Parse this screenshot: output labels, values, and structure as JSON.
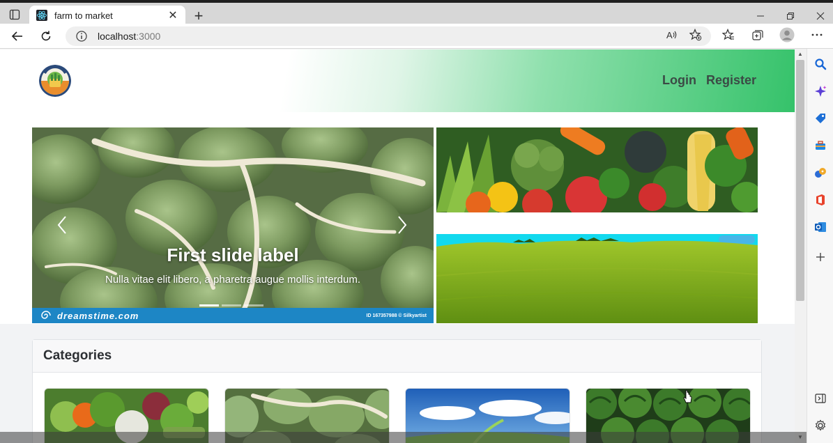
{
  "browser": {
    "tab_title": "farm to market",
    "url_host": "localhost",
    "url_port": ":3000"
  },
  "site": {
    "nav": {
      "login": "Login",
      "register": "Register"
    }
  },
  "carousel": {
    "title": "First slide label",
    "text": "Nulla vitae elit libero, a pharetra augue mollis interdum.",
    "slide_count": 3,
    "active_slide": 1,
    "watermark_brand": "dreamstime.com",
    "watermark_id": "ID 167357988 © Silkyartist"
  },
  "categories": {
    "title": "Categories"
  },
  "colors": {
    "header_green": "#35c26a",
    "nav_text": "#3b4a45",
    "watermark_blue": "#1d86c5"
  }
}
